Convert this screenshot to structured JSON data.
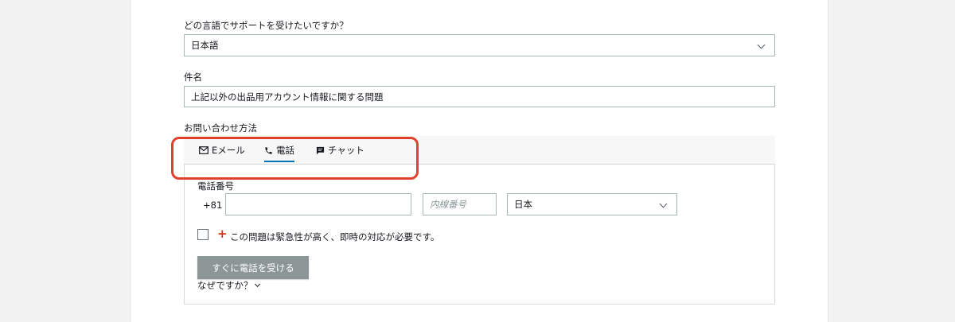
{
  "language_section": {
    "question": "どの言語でサポートを受けたいですか？",
    "selected": "日本語"
  },
  "subject_section": {
    "label": "件名",
    "value": "上記以外の出品用アカウント情報に関する問題"
  },
  "contact_section": {
    "label": "お問い合わせ方法",
    "tabs": [
      {
        "label": "Eメール",
        "icon": "mail-icon"
      },
      {
        "label": "電話",
        "icon": "phone-icon"
      },
      {
        "label": "チャット",
        "icon": "chat-icon"
      }
    ],
    "active_tab": "電話"
  },
  "phone_form": {
    "label": "電話番号",
    "country_code": "+81",
    "number_value": "",
    "extension_placeholder": "内線番号",
    "country_selected": "日本",
    "urgent_plus": "+",
    "urgent_text": "この問題は緊急性が高く、即時の対応が必要です。",
    "call_button": "すぐに電話を受ける",
    "why_link": "なぜですか？"
  },
  "colors": {
    "highlight": "#e0412f",
    "tab_underline": "#0073bb",
    "urgent_plus": "#d13212",
    "disabled_button": "#8d9696"
  }
}
